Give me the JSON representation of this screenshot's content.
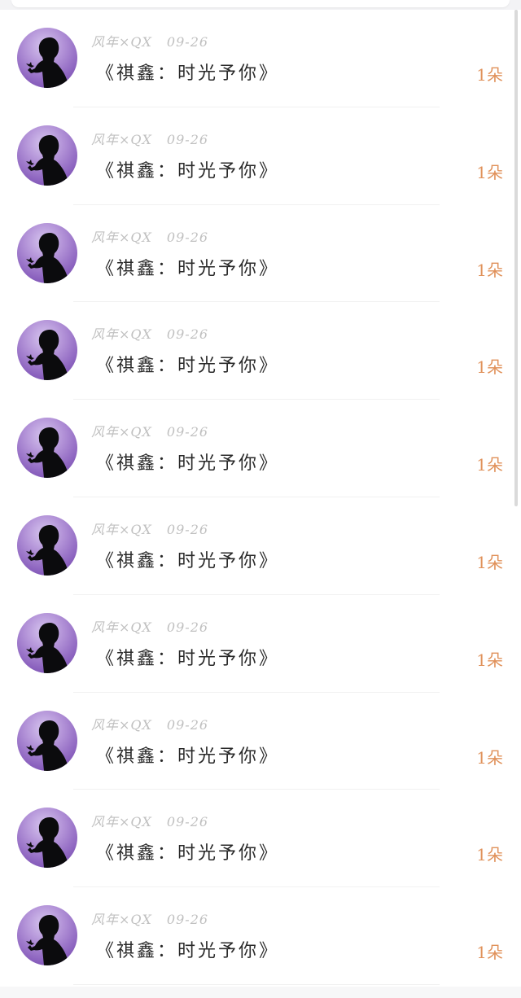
{
  "items": [
    {
      "author": "风年×QX",
      "date": "09-26",
      "title": "《祺鑫：时光予你》",
      "count": "1朵"
    },
    {
      "author": "风年×QX",
      "date": "09-26",
      "title": "《祺鑫：时光予你》",
      "count": "1朵"
    },
    {
      "author": "风年×QX",
      "date": "09-26",
      "title": "《祺鑫：时光予你》",
      "count": "1朵"
    },
    {
      "author": "风年×QX",
      "date": "09-26",
      "title": "《祺鑫：时光予你》",
      "count": "1朵"
    },
    {
      "author": "风年×QX",
      "date": "09-26",
      "title": "《祺鑫：时光予你》",
      "count": "1朵"
    },
    {
      "author": "风年×QX",
      "date": "09-26",
      "title": "《祺鑫：时光予你》",
      "count": "1朵"
    },
    {
      "author": "风年×QX",
      "date": "09-26",
      "title": "《祺鑫：时光予你》",
      "count": "1朵"
    },
    {
      "author": "风年×QX",
      "date": "09-26",
      "title": "《祺鑫：时光予你》",
      "count": "1朵"
    },
    {
      "author": "风年×QX",
      "date": "09-26",
      "title": "《祺鑫：时光予你》",
      "count": "1朵"
    },
    {
      "author": "风年×QX",
      "date": "09-26",
      "title": "《祺鑫：时光予你》",
      "count": "1朵"
    }
  ],
  "avatar_icon": "silhouette-avatar-icon",
  "colors": {
    "count_text": "#e0915a",
    "meta_text": "#c0c0c0",
    "title_text": "#2a2a2a",
    "avatar_purple": "#8c63bf"
  }
}
